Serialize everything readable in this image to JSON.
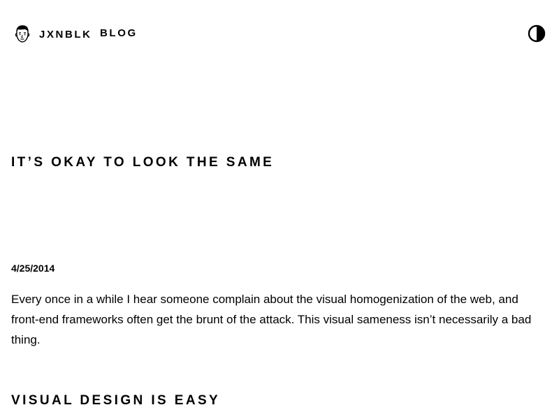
{
  "header": {
    "site_name": "JXNBLK",
    "nav": {
      "blog_label": "BLOG"
    },
    "avatar_icon": "face-avatar-icon",
    "theme_toggle_icon": "contrast-half-circle-icon"
  },
  "post": {
    "title": "IT’S OKAY TO LOOK THE SAME",
    "date": "4/25/2014",
    "intro": "Every once in a while I hear someone complain about the visual homogenization of the web, and front-end frameworks often get the brunt of the attack. This visual sameness isn’t necessarily a bad thing.",
    "section_heading": "VISUAL DESIGN IS EASY"
  },
  "colors": {
    "text": "#000000",
    "background": "#ffffff"
  }
}
